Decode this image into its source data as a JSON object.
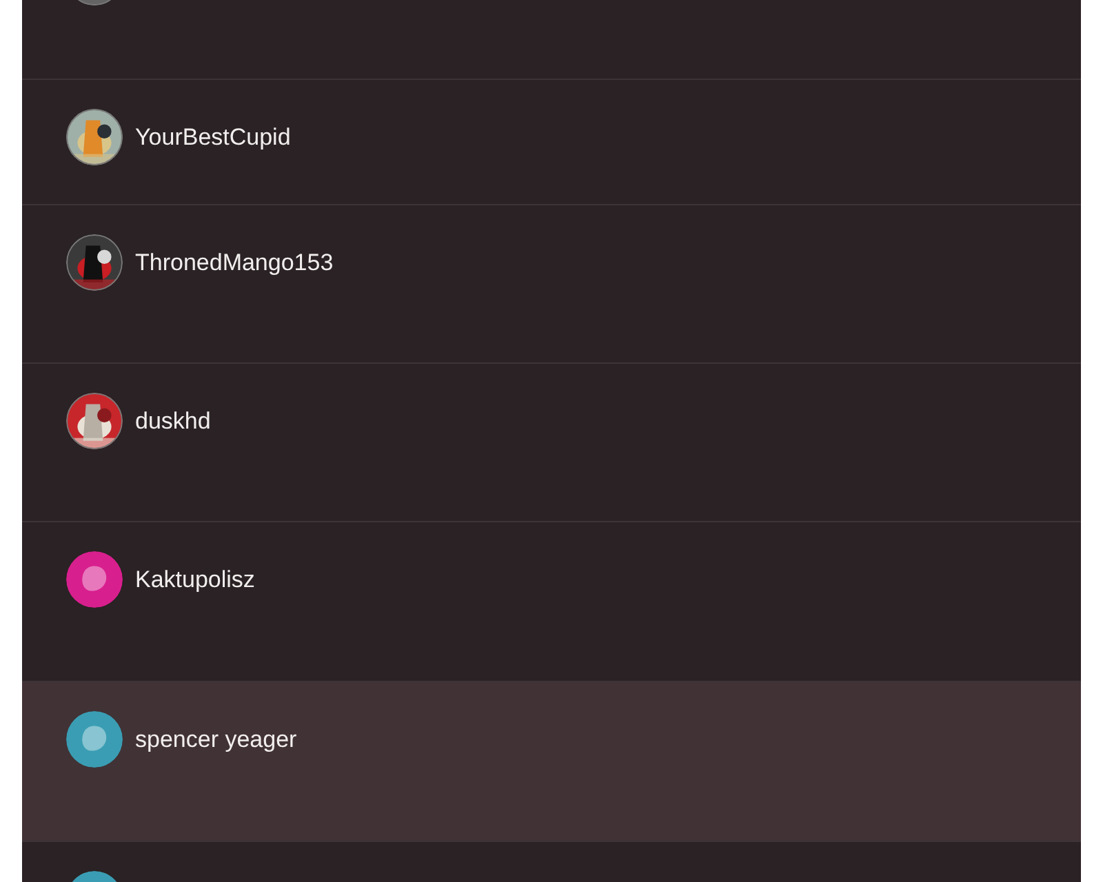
{
  "accounts": [
    {
      "selected": false
    },
    {
      "username": "YourBestCupid",
      "selected": false
    },
    {
      "username": "ThronedMango153",
      "selected": false
    },
    {
      "username": "duskhd",
      "selected": false
    },
    {
      "username": "Kaktupolisz",
      "avatar": {
        "kind": "default",
        "color": "#d81f8e"
      },
      "selected": false
    },
    {
      "username": "spencer yeager",
      "avatar": {
        "kind": "default",
        "color": "#3a9db3"
      },
      "selected": true
    },
    {
      "avatar": {
        "kind": "default",
        "color": "#3a9db3"
      },
      "selected": false
    }
  ]
}
